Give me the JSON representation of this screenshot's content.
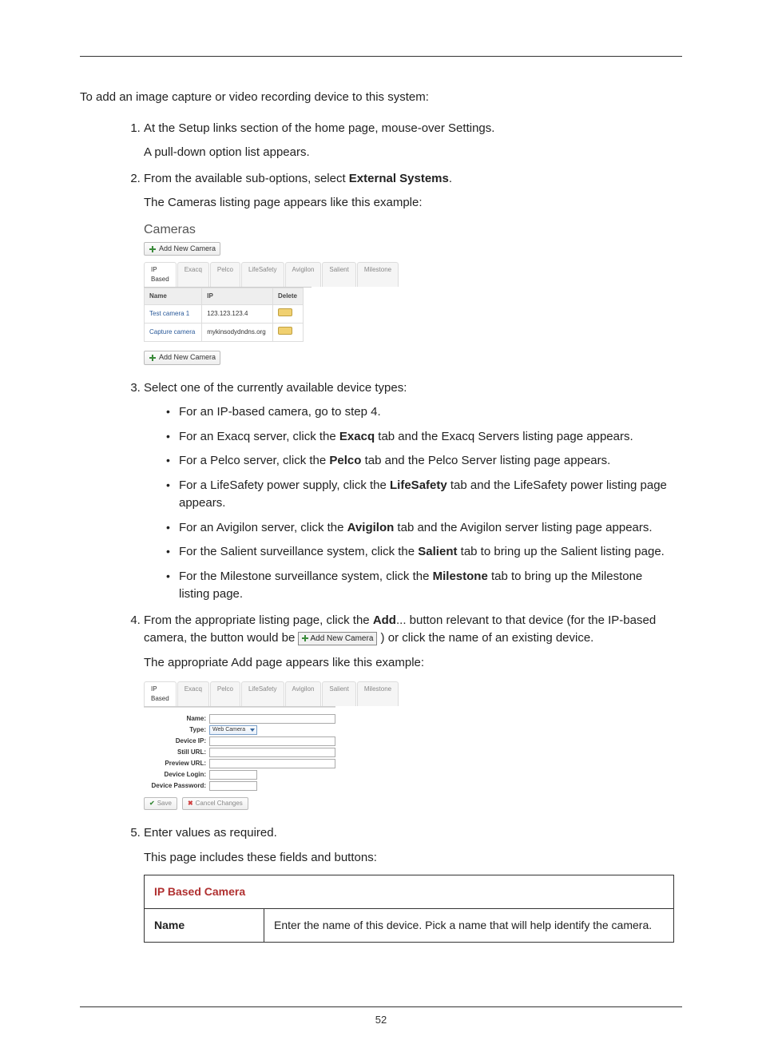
{
  "intro": "To add an image capture or video recording device to this system:",
  "steps": {
    "s1": "At the Setup links section of the home page, mouse-over Settings.",
    "s1b": "A pull-down option list appears.",
    "s2a": "From the available sub-options, select ",
    "s2bold": "External Systems",
    "s2c": ".",
    "s2d": "The Cameras listing page appears like this example:",
    "s3": "Select one of the currently available device types:",
    "s3items": {
      "a": "For an IP-based camera, go to step 4.",
      "b_pre": "For an Exacq server, click the ",
      "b_bold": "Exacq",
      "b_post": " tab and the Exacq Servers listing page appears.",
      "c_pre": "For a Pelco server, click the ",
      "c_bold": "Pelco",
      "c_post": " tab and the Pelco Server listing page appears.",
      "d_pre": "For a LifeSafety power supply, click the ",
      "d_bold": "LifeSafety",
      "d_post": " tab and the LifeSafety power listing page appears.",
      "e_pre": "For an Avigilon server, click the ",
      "e_bold": "Avigilon",
      "e_post": " tab and the Avigilon server listing page appears.",
      "f_pre": "For the Salient surveillance system, click the ",
      "f_bold": "Salient",
      "f_post": " tab to bring up the Salient listing page.",
      "g_pre": "For the Milestone surveillance system, click the ",
      "g_bold": "Milestone",
      "g_post": " tab to bring up the Milestone listing page."
    },
    "s4a": "From the appropriate listing page, click the ",
    "s4bold": "Add",
    "s4b": "... button relevant to that device (for the IP-based camera, the button would be ",
    "s4c": " ) or click the name of an existing device.",
    "s4d": "The appropriate Add page appears like this example:",
    "s5": "Enter values as required.",
    "s5b": "This page includes these fields and buttons:"
  },
  "fig1": {
    "title": "Cameras",
    "add_btn": "Add New Camera",
    "tabs": [
      "IP Based",
      "Exacq",
      "Pelco",
      "LifeSafety",
      "Avigilon",
      "Salient",
      "Milestone"
    ],
    "headers": {
      "name": "Name",
      "ip": "IP",
      "delete": "Delete"
    },
    "rows": [
      {
        "name": "Test camera 1",
        "ip": "123.123.123.4"
      },
      {
        "name": "Capture camera",
        "ip": "mykinsodydndns.org"
      }
    ]
  },
  "inline_btn": "Add New Camera",
  "fig2": {
    "tabs": [
      "IP Based",
      "Exacq",
      "Pelco",
      "LifeSafety",
      "Avigilon",
      "Salient",
      "Milestone"
    ],
    "labels": {
      "name": "Name:",
      "type": "Type:",
      "type_val": "Web Camera",
      "device_ip": "Device IP:",
      "still_url": "Still URL:",
      "preview_url": "Preview URL:",
      "device_login": "Device Login:",
      "device_password": "Device Password:"
    },
    "save": "Save",
    "cancel": "Cancel Changes"
  },
  "table": {
    "header": "IP Based Camera",
    "row1_label": "Name",
    "row1_desc": "Enter the name of this device. Pick a name that will help identify the camera."
  },
  "page_number": "52"
}
